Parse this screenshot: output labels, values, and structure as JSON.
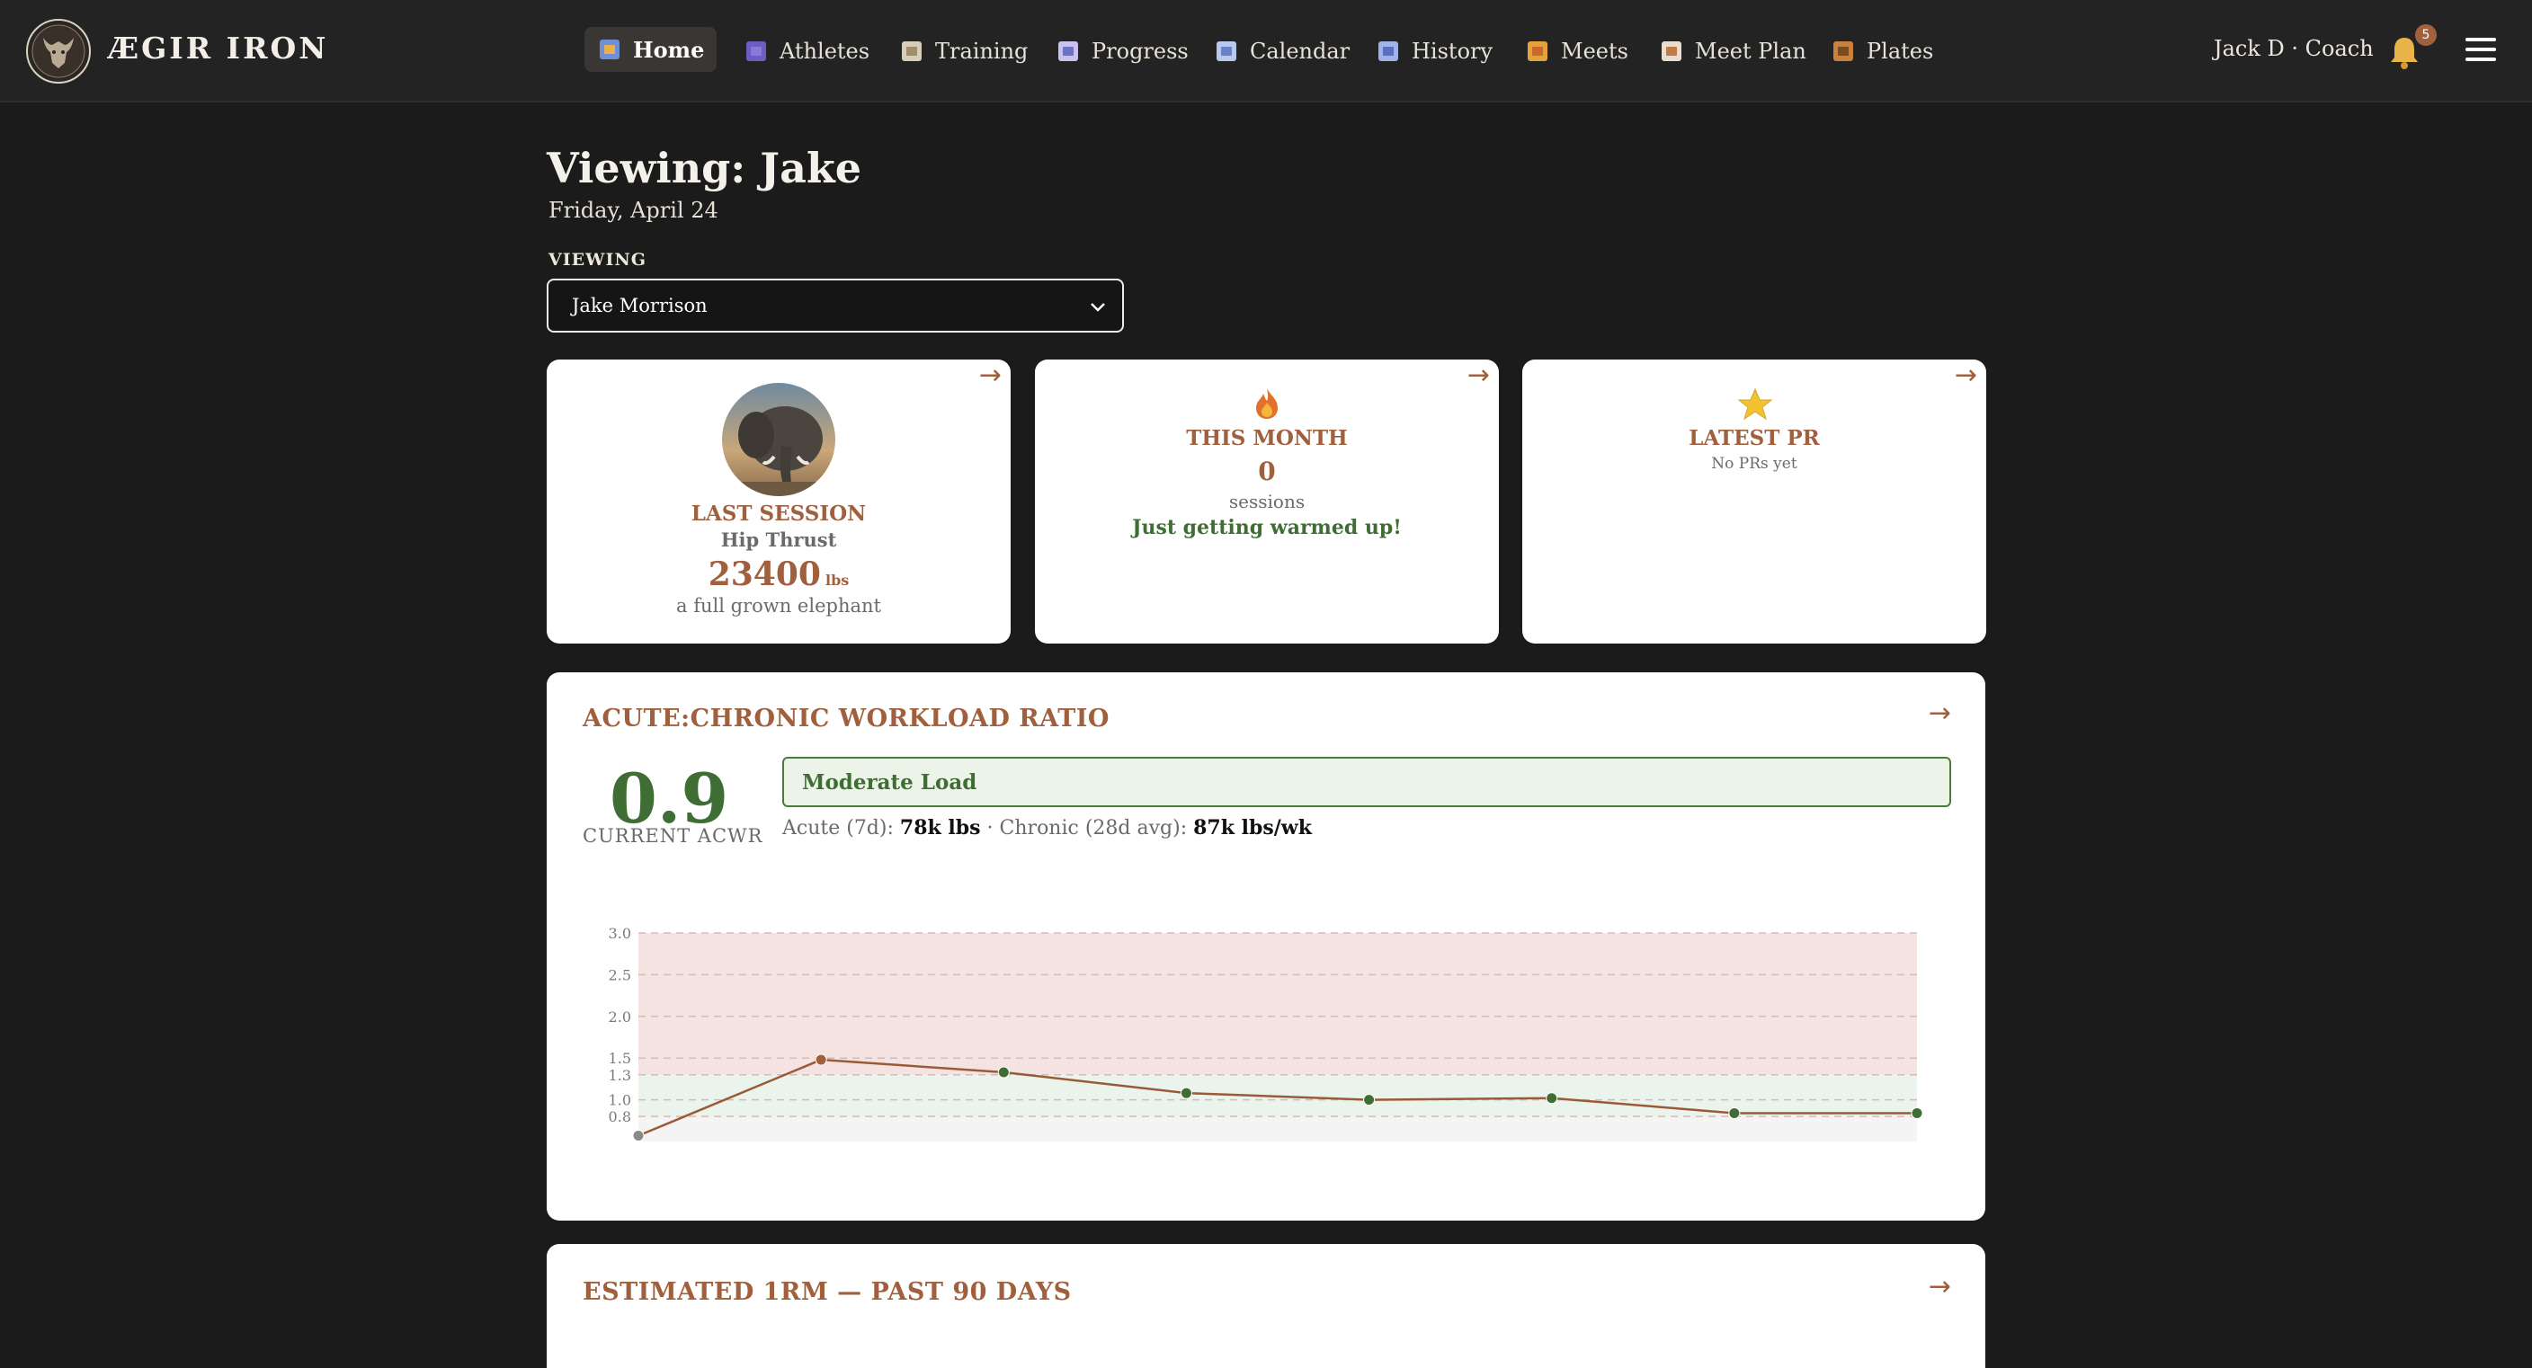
{
  "app": {
    "brand": "ÆGIR IRON",
    "user": "Jack D · Coach",
    "notification_count": "5"
  },
  "nav": {
    "items": [
      {
        "label": "Home",
        "icon": "home-icon",
        "active": true
      },
      {
        "label": "Athletes",
        "icon": "athletes-icon",
        "active": false
      },
      {
        "label": "Training",
        "icon": "training-icon",
        "active": false
      },
      {
        "label": "Progress",
        "icon": "progress-icon",
        "active": false
      },
      {
        "label": "Calendar",
        "icon": "calendar-icon",
        "active": false
      },
      {
        "label": "History",
        "icon": "history-icon",
        "active": false
      },
      {
        "label": "Meets",
        "icon": "medal-icon",
        "active": false
      },
      {
        "label": "Meet Plan",
        "icon": "meet-plan-icon",
        "active": false
      },
      {
        "label": "Plates",
        "icon": "plates-icon",
        "active": false
      }
    ]
  },
  "header": {
    "title": "Viewing: Jake",
    "date": "Friday, April 24",
    "viewing_label": "VIEWING",
    "selected_athlete": "Jake Morrison"
  },
  "cards": {
    "last_session": {
      "heading": "LAST SESSION",
      "exercise": "Hip Thrust",
      "value": "23400",
      "unit": "lbs",
      "comparison": "a full grown elephant",
      "arrow": "→"
    },
    "this_month": {
      "heading": "THIS MONTH",
      "value": "0",
      "unit": "sessions",
      "message": "Just getting warmed up!",
      "arrow": "→"
    },
    "latest_pr": {
      "heading": "LATEST PR",
      "message": "No PRs yet",
      "arrow": "→"
    }
  },
  "acwr": {
    "title": "ACUTE:CHRONIC WORKLOAD RATIO",
    "arrow": "→",
    "value": "0.9",
    "caption": "CURRENT ACWR",
    "status": "Moderate Load",
    "acute_label": "Acute (7d):",
    "acute_value": "78k lbs",
    "separator": "·",
    "chronic_label": "Chronic (28d avg):",
    "chronic_value": "87k lbs/wk"
  },
  "one_rm": {
    "title": "ESTIMATED 1RM — PAST 90 DAYS",
    "arrow": "→"
  },
  "colors": {
    "accent": "#a0603d",
    "good": "#3f6e34",
    "danger_zone": "#f5e3e2",
    "safe_zone": "#eaf4ec",
    "background": "#1b1b1b"
  },
  "chart_data": {
    "type": "line",
    "title": "",
    "xlabel": "",
    "ylabel": "",
    "y_ticks": [
      "3.0",
      "2.5",
      "2.0",
      "1.5",
      "1.3",
      "1.0",
      "0.8"
    ],
    "ylim": [
      0.5,
      3.0
    ],
    "grid": true,
    "bands": [
      {
        "from": 1.3,
        "to": 3.0,
        "color": "#f5e3e2"
      },
      {
        "from": 0.8,
        "to": 1.3,
        "color": "#eaf4ec"
      }
    ],
    "series": [
      {
        "values": [
          0.57,
          1.48,
          1.33,
          1.08,
          1.0,
          1.02,
          0.84,
          0.84
        ],
        "point_colors": [
          "#8a8a8a",
          "#a0603d",
          "#3f6e34",
          "#3f6e34",
          "#3f6e34",
          "#3f6e34",
          "#3f6e34",
          "#3f6e34"
        ]
      }
    ]
  }
}
